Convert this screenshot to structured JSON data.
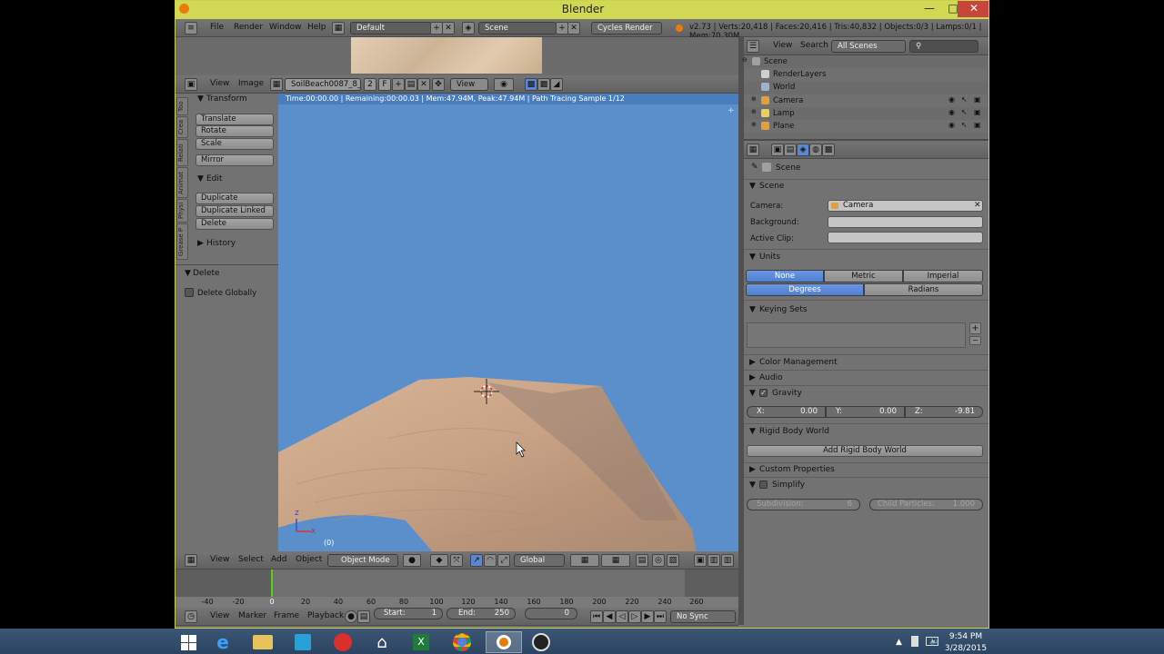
{
  "window": {
    "title": "Blender",
    "min": "—",
    "max": "□",
    "close": "✕"
  },
  "info_header": {
    "menus": [
      "File",
      "Render",
      "Window",
      "Help"
    ],
    "layout": "Default",
    "scene": "Scene",
    "engine": "Cycles Render",
    "stats": "v2.73 | Verts:20,418 | Faces:20,416 | Tris:40,832 | Objects:0/3 | Lamps:0/1 | Mem:70.30M"
  },
  "image_header": {
    "menus": [
      "View",
      "Image"
    ],
    "image_name": "SoilBeach0087_8_...",
    "users": "2",
    "fake": "F",
    "view_label": "View"
  },
  "render_status": "Time:00:00.00 | Remaining:00:00.03 | Mem:47.94M, Peak:47.94M | Path Tracing Sample 1/12",
  "toolshelf": {
    "tabs": [
      "Too",
      "Crea",
      "Relati",
      "Animat",
      "Physi",
      "Grease P"
    ],
    "transform_title": "Transform",
    "transform_buttons": [
      "Translate",
      "Rotate",
      "Scale"
    ],
    "mirror": "Mirror",
    "edit_title": "Edit",
    "edit_buttons": [
      "Duplicate",
      "Duplicate Linked",
      "Delete"
    ],
    "history_title": "History",
    "operator_title": "Delete",
    "delete_globally": "Delete Globally"
  },
  "viewport": {
    "frame_label": "(0)",
    "axis_z": "Z",
    "axis_x": "X"
  },
  "viewport_header": {
    "menus": [
      "View",
      "Select",
      "Add",
      "Object"
    ],
    "mode": "Object Mode",
    "orientation": "Global"
  },
  "timeline": {
    "ticks": [
      "-40",
      "-20",
      "0",
      "20",
      "40",
      "60",
      "80",
      "100",
      "120",
      "140",
      "160",
      "180",
      "200",
      "220",
      "240",
      "260"
    ],
    "menus": [
      "View",
      "Marker",
      "Frame",
      "Playback"
    ],
    "start_label": "Start:",
    "start": "1",
    "end_label": "End:",
    "end": "250",
    "current": "0",
    "sync": "No Sync"
  },
  "outliner": {
    "menus": [
      "View",
      "Search"
    ],
    "filter": "All Scenes",
    "items": [
      {
        "label": "Scene",
        "icon": "scene-icon",
        "color": "#a0a0a0",
        "indent": 0
      },
      {
        "label": "RenderLayers",
        "icon": "renderlayers-icon",
        "color": "#cfcfcf",
        "indent": 1
      },
      {
        "label": "World",
        "icon": "world-icon",
        "color": "#9fb3c8",
        "indent": 1
      },
      {
        "label": "Camera",
        "icon": "camera-icon",
        "color": "#e0a040",
        "indent": 1
      },
      {
        "label": "Lamp",
        "icon": "lamp-icon",
        "color": "#e8d060",
        "indent": 1
      },
      {
        "label": "Plane",
        "icon": "plane-icon",
        "color": "#e0a040",
        "indent": 1
      }
    ]
  },
  "properties": {
    "context": "Scene",
    "scene_title": "Scene",
    "camera_label": "Camera:",
    "camera_value": "Camera",
    "background_label": "Background:",
    "active_clip_label": "Active Clip:",
    "units_title": "Units",
    "unit_systems": [
      "None",
      "Metric",
      "Imperial"
    ],
    "rotation_units": [
      "Degrees",
      "Radians"
    ],
    "keying_sets_title": "Keying Sets",
    "color_mgmt_title": "Color Management",
    "audio_title": "Audio",
    "gravity_title": "Gravity",
    "gravity": [
      {
        "label": "X:",
        "value": "0.00"
      },
      {
        "label": "Y:",
        "value": "0.00"
      },
      {
        "label": "Z:",
        "value": "-9.81"
      }
    ],
    "rigid_body_title": "Rigid Body World",
    "add_rigid_body": "Add Rigid Body World",
    "custom_props_title": "Custom Properties",
    "simplify_title": "Simplify",
    "subdivision_label": "Subdivision:",
    "subdivision_value": "6",
    "child_particles_label": "Child Particles:",
    "child_particles_value": "1.000"
  },
  "taskbar": {
    "time": "9:54 PM",
    "date": "3/28/2015"
  }
}
